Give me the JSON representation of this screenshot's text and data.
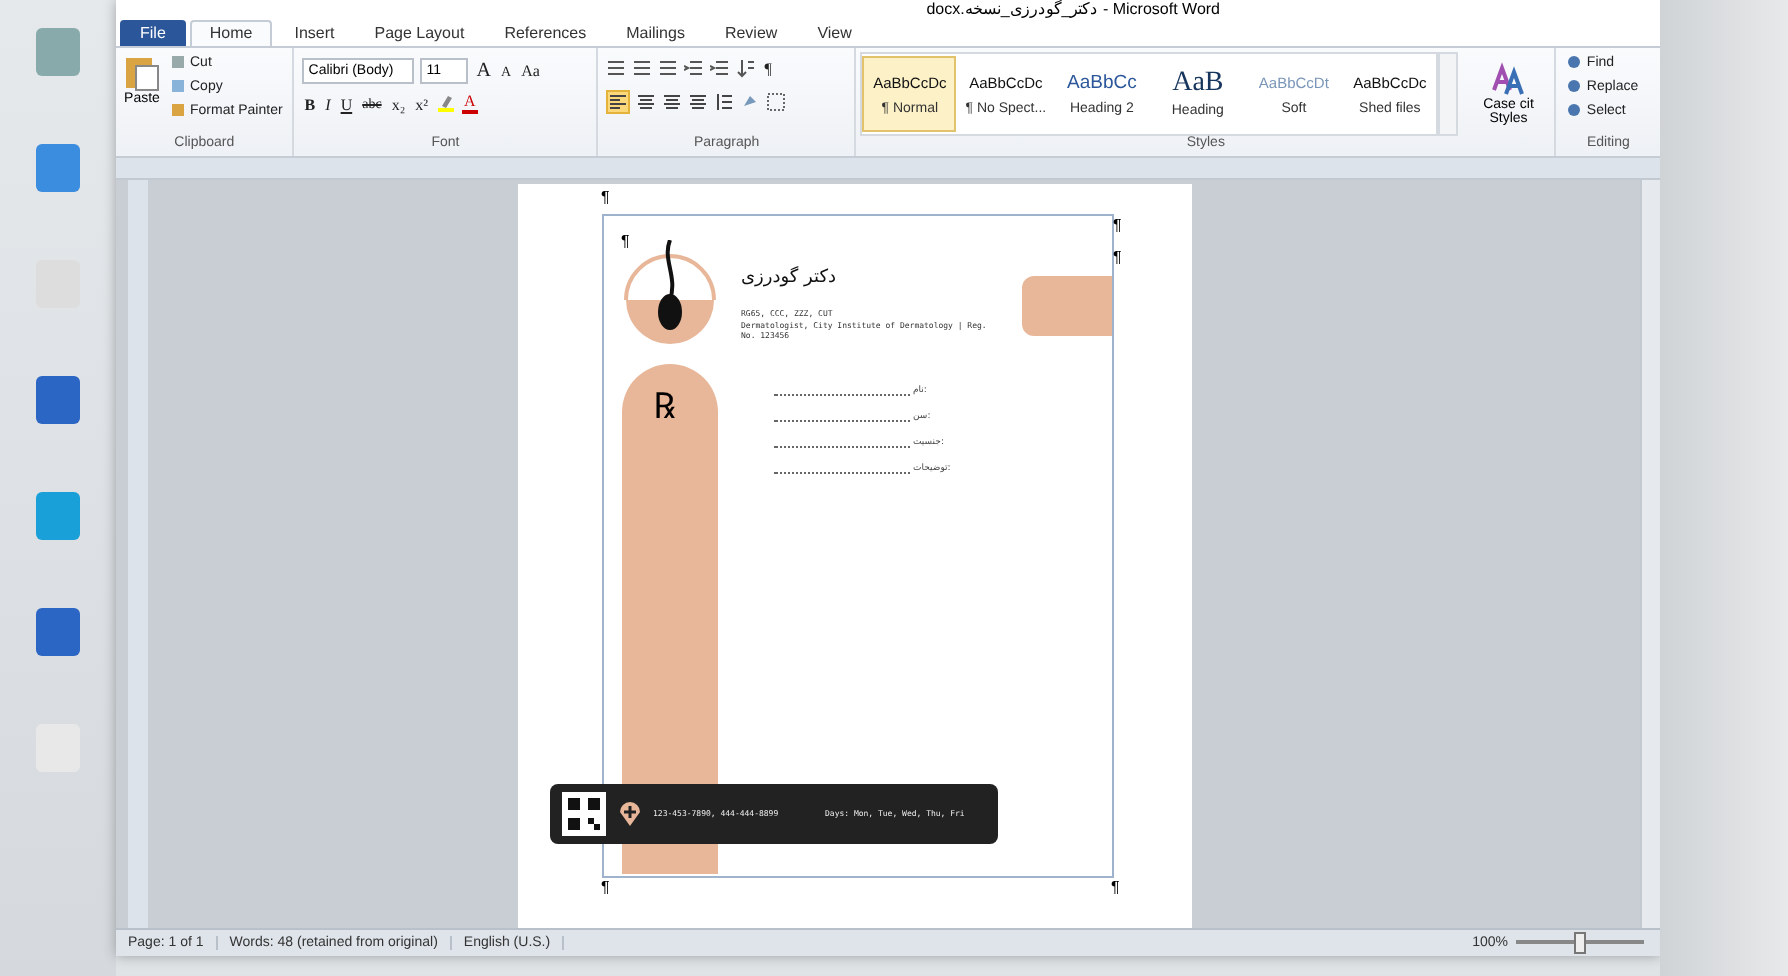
{
  "window": {
    "title": "docx.دکتر_گودرزی_نسخه - Microsoft Word"
  },
  "tabs": [
    {
      "label": "File",
      "kind": "file",
      "selected": false
    },
    {
      "label": "Home",
      "kind": "tab",
      "selected": true
    },
    {
      "label": "Insert",
      "kind": "tab",
      "selected": false
    },
    {
      "label": "Page Layout",
      "kind": "tab",
      "selected": false
    },
    {
      "label": "References",
      "kind": "tab",
      "selected": false
    },
    {
      "label": "Mailings",
      "kind": "tab",
      "selected": false
    },
    {
      "label": "Review",
      "kind": "tab",
      "selected": false
    },
    {
      "label": "View",
      "kind": "tab",
      "selected": false
    }
  ],
  "clipboard": {
    "paste": "Paste",
    "items": [
      "Cut",
      "Copy",
      "Format Painter"
    ],
    "group": "Clipboard"
  },
  "font": {
    "name": "Calibri (Body)",
    "size": "11",
    "group": "Font",
    "case_button": "Aa",
    "bold": "B",
    "italic": "I",
    "underline": "U",
    "strike": "abc",
    "subscript": "x₂",
    "superscript": "x²",
    "grow": "A",
    "shrink": "A",
    "color_letter": "A"
  },
  "paragraph": {
    "group": "Paragraph",
    "pilcrow": "¶",
    "align_left_selected": true
  },
  "styles": {
    "group": "Styles",
    "items": [
      {
        "preview": "AaBbCcDc",
        "name": "¶ Normal",
        "kind": "normal",
        "selected": true
      },
      {
        "preview": "AaBbCcDc",
        "name": "¶ No Spect...",
        "kind": "normal",
        "selected": false
      },
      {
        "preview": "AaBbCc",
        "name": "Heading 2",
        "kind": "heading2",
        "selected": false
      },
      {
        "preview": "AaB",
        "name": "Heading",
        "kind": "title",
        "selected": false
      },
      {
        "preview": "AaBbCcDt",
        "name": "Soft",
        "kind": "soft",
        "selected": false
      },
      {
        "preview": "AaBbCcDc",
        "name": "Shed files",
        "kind": "normal",
        "selected": false
      }
    ],
    "change": "Case cit Styles"
  },
  "editing": {
    "group": "Editing",
    "items": [
      "Find",
      "Replace",
      "Select"
    ]
  },
  "document": {
    "doctor_name": "دکتر گودرزی",
    "credentials": "RG65, CCC, ZZZ, CUT",
    "subtitle": "Dermatologist, City Institute of Dermatology | Reg. No. 123456",
    "rx": "℞",
    "fields": [
      "نام:",
      "سن:",
      "جنسیت:",
      "توضیحات:"
    ],
    "phones": "123-453-7890, 444-444-8899",
    "days": "Days: Mon, Tue, Wed, Thu, Fri",
    "pilcrow": "¶"
  },
  "status_bar": {
    "page": "Page: 1 of 1",
    "words": "Words: 48 (retained from original)",
    "language": "English (U.S.)",
    "zoom": "100%",
    "level": 0.5
  }
}
